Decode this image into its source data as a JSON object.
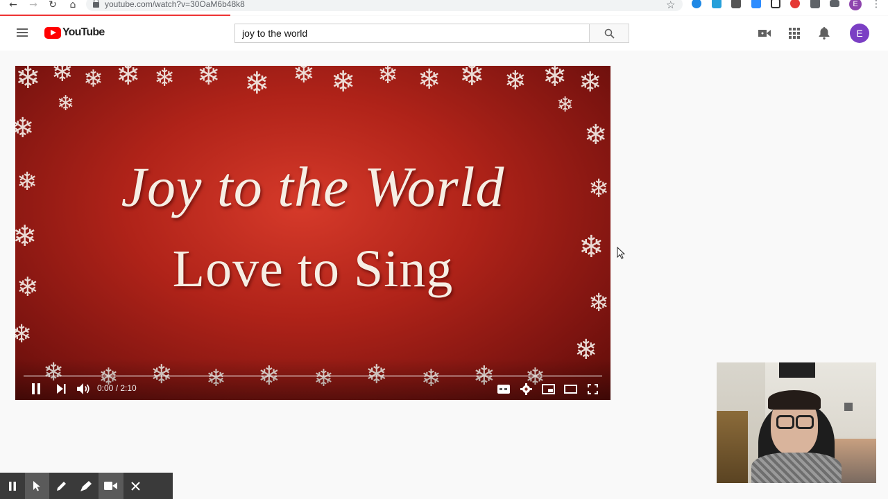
{
  "browser": {
    "url": "youtube.com/watch?v=30OaM6b48k8",
    "profile_initial": "E",
    "extensions": [
      "grammar-icon",
      "account-icon",
      "l-icon",
      "zoom-icon",
      "grid-icon",
      "record-icon",
      "puzzle-icon",
      "queue-icon"
    ]
  },
  "masthead": {
    "logo_text": "YouTube",
    "search_value": "joy to the world",
    "avatar_initial": "E"
  },
  "player": {
    "title_line1": "Joy to the World",
    "title_line2": "Love to Sing",
    "time_display": "0:00 / 2:10",
    "progress_fraction": 0.0
  },
  "recorder": {
    "buttons": [
      "pause-icon",
      "pointer-icon",
      "pen-icon",
      "highlighter-icon",
      "camera-icon",
      "close-icon"
    ]
  },
  "colors": {
    "brand": "#ff0000",
    "avatar": "#7b3fc4",
    "player_red": "#b02319"
  }
}
